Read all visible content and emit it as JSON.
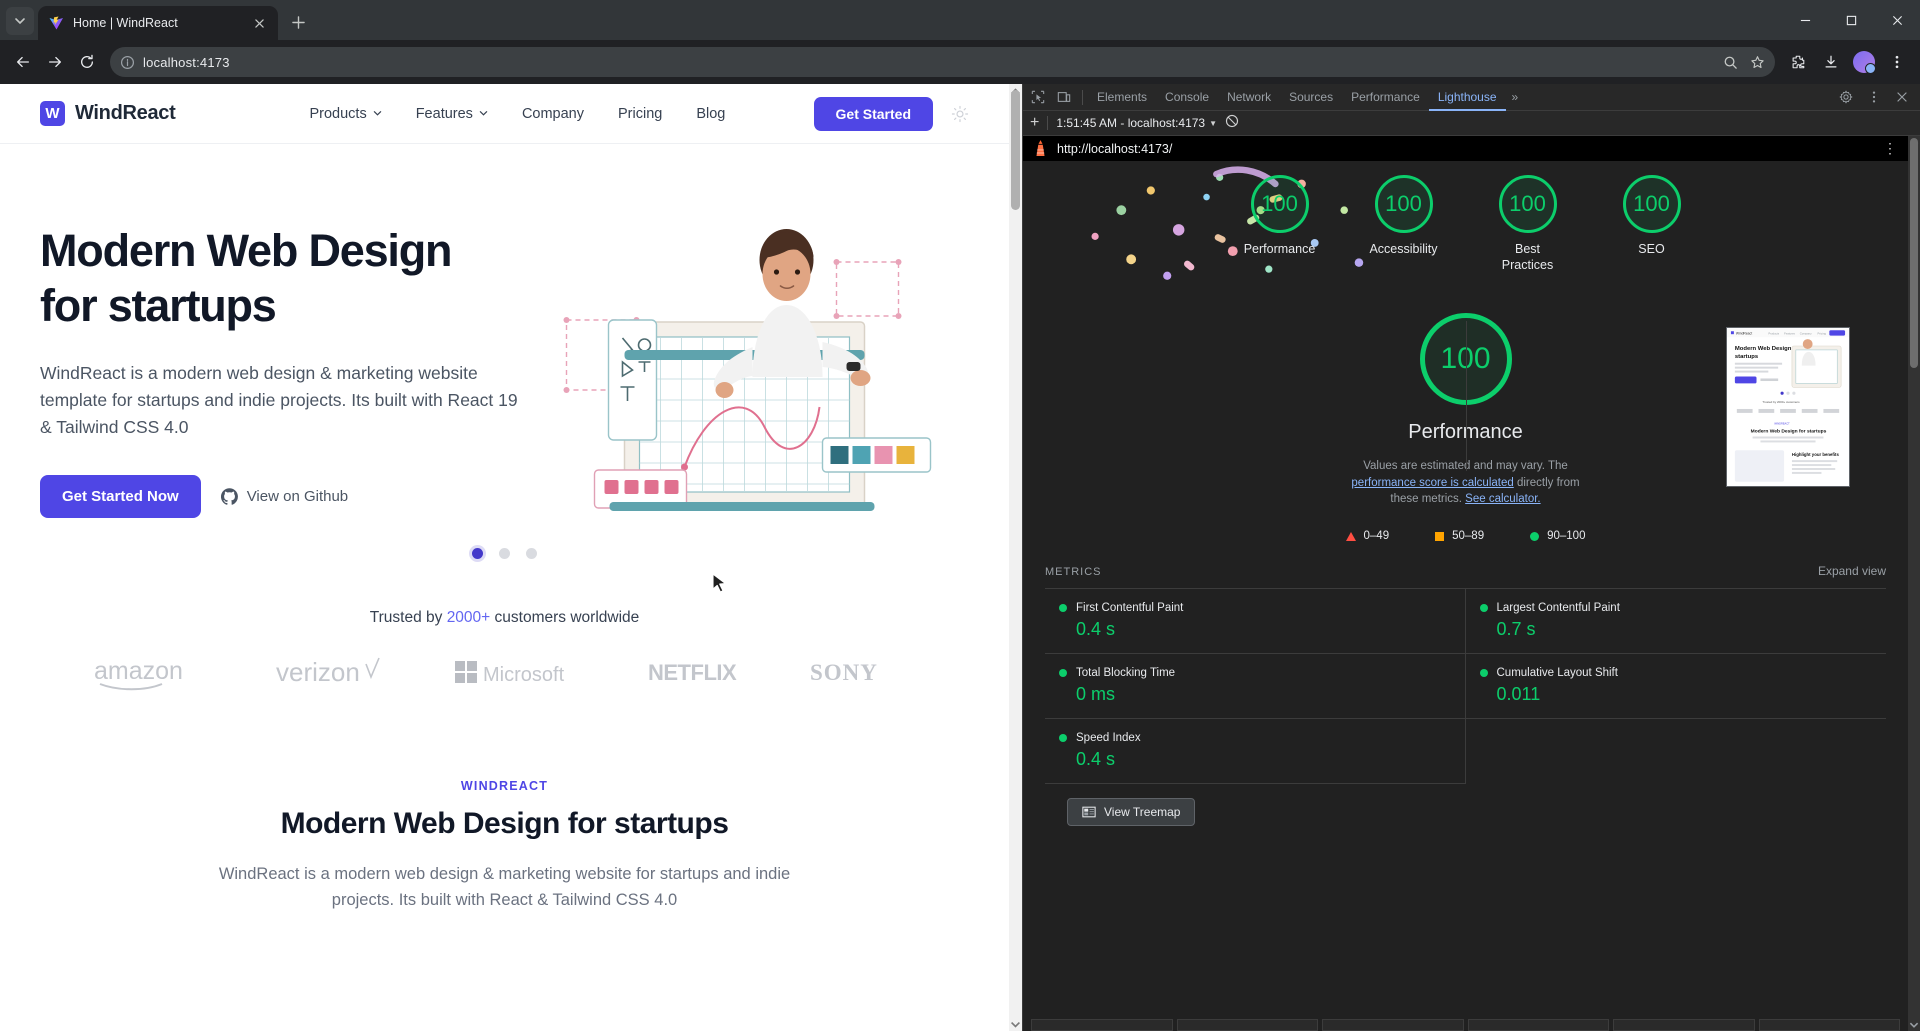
{
  "browser": {
    "tab": {
      "title": "Home | WindReact",
      "favicon": "vite-logo-icon",
      "close": "close-icon"
    },
    "new_tab": "+",
    "url": "localhost:4173",
    "window": {
      "minimize": "minimize-icon",
      "maximize": "maximize-icon",
      "close": "close-icon"
    }
  },
  "site": {
    "brand": {
      "mark": "W",
      "name": "WindReact"
    },
    "nav": [
      {
        "label": "Products",
        "dropdown": true
      },
      {
        "label": "Features",
        "dropdown": true
      },
      {
        "label": "Company",
        "dropdown": false
      },
      {
        "label": "Pricing",
        "dropdown": false
      },
      {
        "label": "Blog",
        "dropdown": false
      }
    ],
    "cta": "Get Started",
    "hero": {
      "title_line1": "Modern Web Design",
      "title_line2": "for startups",
      "subtitle": "WindReact is a modern web design & marketing website template for startups and indie projects. Its built with React 19 & Tailwind CSS 4.0",
      "primary_btn": "Get Started Now",
      "secondary_btn": "View on Github"
    },
    "trusted": {
      "prefix": "Trusted by ",
      "count": "2000+",
      "suffix": " customers worldwide"
    },
    "logos": [
      "amazon",
      "verizon",
      "Microsoft",
      "NETFLIX",
      "SONY"
    ],
    "feature": {
      "eyebrow": "WINDREACT",
      "heading": "Modern Web Design for startups",
      "body": "WindReact is a modern web design & marketing website for startups and indie projects. Its built with React & Tailwind CSS 4.0"
    }
  },
  "devtools": {
    "tabs": [
      "Elements",
      "Console",
      "Network",
      "Sources",
      "Performance",
      "Lighthouse"
    ],
    "selected_tab": "Lighthouse",
    "overflow": "»",
    "lighthouse": {
      "toolbar": {
        "add": "+",
        "timestamp": "1:51:45 AM - localhost:4173",
        "clear": "clear-icon"
      },
      "report_url": "http://localhost:4173/",
      "categories": [
        {
          "label": "Performance",
          "score": "100"
        },
        {
          "label": "Accessibility",
          "score": "100"
        },
        {
          "label": "Best\nPractices",
          "score": "100"
        },
        {
          "label": "SEO",
          "score": "100"
        }
      ],
      "hero": {
        "score": "100",
        "title": "Performance",
        "disclaimer_1": "Values are estimated and may vary. The ",
        "link_1": "performance score is calculated",
        "disclaimer_2": " directly from these metrics. ",
        "link_2": "See calculator."
      },
      "legend": [
        {
          "range": "0–49",
          "shape": "triangle",
          "color": "#ff4e42"
        },
        {
          "range": "50–89",
          "shape": "square",
          "color": "#ffa400"
        },
        {
          "range": "90–100",
          "shape": "circle",
          "color": "#0cce6b"
        }
      ],
      "metrics_title": "METRICS",
      "expand_view": "Expand view",
      "metrics": [
        {
          "name": "First Contentful Paint",
          "value": "0.4 s"
        },
        {
          "name": "Largest Contentful Paint",
          "value": "0.7 s"
        },
        {
          "name": "Total Blocking Time",
          "value": "0 ms"
        },
        {
          "name": "Cumulative Layout Shift",
          "value": "0.011"
        },
        {
          "name": "Speed Index",
          "value": "0.4 s"
        }
      ],
      "treemap_btn": "View Treemap"
    }
  },
  "colors": {
    "brand": "#4f46e5",
    "good": "#0cce6b",
    "average": "#ffa400",
    "poor": "#ff4e42",
    "devtools_accent": "#8ab4f8"
  }
}
